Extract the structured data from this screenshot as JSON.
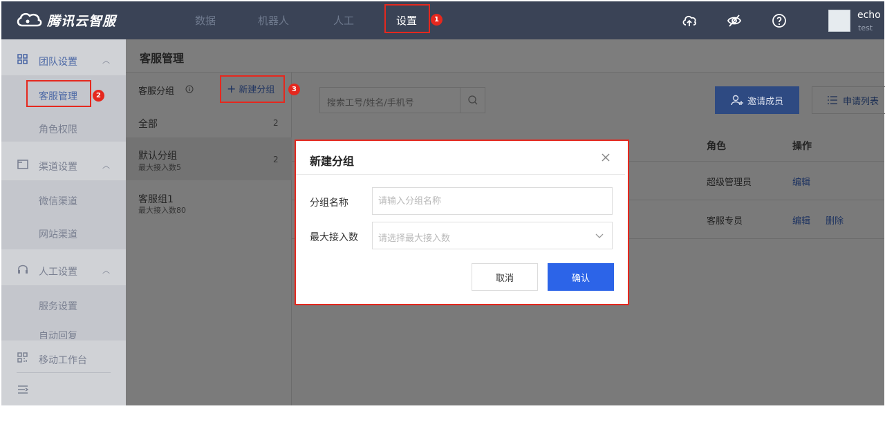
{
  "brand": {
    "name": "腾讯云智服"
  },
  "nav": {
    "items": [
      {
        "label": "数据"
      },
      {
        "label": "机器人"
      },
      {
        "label": "人工"
      },
      {
        "label": "设置",
        "active": true
      }
    ]
  },
  "header_icons": [
    "cloud-upload-icon",
    "eye-off-icon",
    "help-icon"
  ],
  "user": {
    "name": "echo",
    "account": "test"
  },
  "sidebar": {
    "groups": [
      {
        "label": "团队设置",
        "icon": "grid-icon",
        "expanded": true,
        "items": [
          {
            "label": "客服管理",
            "active": true
          },
          {
            "label": "角色权限"
          }
        ]
      },
      {
        "label": "渠道设置",
        "icon": "window-icon",
        "expanded": true,
        "items": [
          {
            "label": "微信渠道"
          },
          {
            "label": "网站渠道"
          }
        ]
      },
      {
        "label": "人工设置",
        "icon": "headset-icon",
        "expanded": true,
        "items": [
          {
            "label": "服务设置"
          },
          {
            "label": "自动回复"
          }
        ]
      }
    ],
    "bottom": [
      {
        "label": "移动工作台",
        "icon": "qr-icon"
      }
    ],
    "collapse_icon": "menu-collapse-icon"
  },
  "page": {
    "title": "客服管理"
  },
  "groups_panel": {
    "title": "客服分组",
    "new_group_label": "新建分组",
    "list": [
      {
        "name": "全部",
        "count": "2"
      },
      {
        "name": "默认分组",
        "sub": "最大接入数5",
        "count": "2"
      },
      {
        "name": "客服组1",
        "sub": "最大接入数80"
      }
    ]
  },
  "main": {
    "search_placeholder": "搜索工号/姓名/手机号",
    "invite_label": "邀请成员",
    "apply_list_label": "申请列表",
    "table": {
      "headers": {
        "role": "角色",
        "action": "操作"
      },
      "rows": [
        {
          "role": "超级管理员",
          "actions": [
            "编辑"
          ]
        },
        {
          "role": "客服专员",
          "actions": [
            "编辑",
            "删除"
          ]
        }
      ]
    }
  },
  "modal": {
    "title": "新建分组",
    "fields": {
      "name": {
        "label": "分组名称",
        "placeholder": "请输入分组名称"
      },
      "max": {
        "label": "最大接入数",
        "placeholder": "请选择最大接入数"
      }
    },
    "cancel_label": "取消",
    "confirm_label": "确认"
  },
  "annotations": [
    "1",
    "2",
    "3"
  ],
  "colors": {
    "header_bg": "#3a4356",
    "accent": "#2c64e8",
    "highlight": "#e5281e"
  }
}
